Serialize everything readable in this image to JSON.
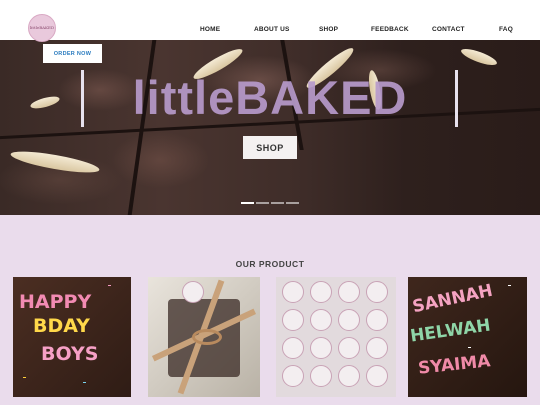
{
  "brand": {
    "logo_text": "littleBAKED"
  },
  "nav": [
    {
      "label": "HOME"
    },
    {
      "label": "ABOUT US"
    },
    {
      "label": "SHOP"
    },
    {
      "label": "FEEDBACK"
    },
    {
      "label": "CONTACT"
    },
    {
      "label": "FAQ"
    }
  ],
  "hero": {
    "order_button": "ORDER NOW",
    "title": "littleBAKED",
    "shop_button": "SHOP",
    "slides": 4,
    "active_slide": 1
  },
  "products": {
    "title": "OUR PRODUCT",
    "items": [
      {
        "text": "HAPPY BDAY BOYS"
      },
      {
        "text": ""
      },
      {
        "text": ""
      },
      {
        "text": "SANNAH HELWAH SYAIMA"
      }
    ]
  },
  "colors": {
    "accent": "#b79acb",
    "section_bg": "#eadcec",
    "order_text": "#2a7bbf"
  }
}
